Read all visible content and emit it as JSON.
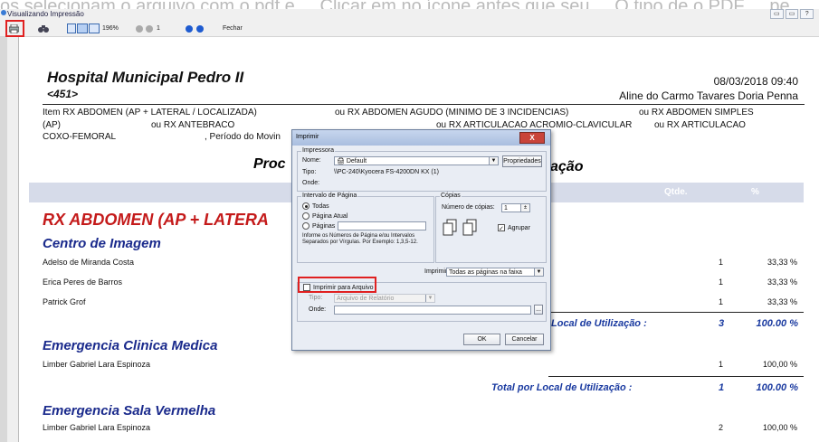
{
  "background_text": "os selecionam o arquivo com o pdf e ... Clicar em no ícone antes que seu ... O tipo de o PDF ... pe",
  "window": {
    "title": "Visualizando Impressão",
    "controls": [
      "▭",
      "▭",
      "?"
    ]
  },
  "toolbar": {
    "zoom": "196%",
    "page": "1",
    "close_label": "Fechar"
  },
  "report": {
    "hospital": "Hospital Municipal Pedro II",
    "code": "<451>",
    "datetime": "08/03/2018 09:40",
    "user": "Aline do Carmo Tavares Doria Penna",
    "filter_lines": [
      [
        "Item RX ABDOMEN (AP + LATERAL / LOCALIZADA)",
        "ou RX ABDOMEN AGUDO (MINIMO DE 3 INCIDENCIAS)",
        "ou RX ABDOMEN SIMPLES"
      ],
      [
        "(AP)",
        "ou RX ANTEBRACO",
        "ou RX ARTICULACAO ACROMIO-CLAVICULAR",
        "ou RX ARTICULACAO"
      ],
      [
        "COXO-FEMORAL",
        ", Período do Movin"
      ]
    ],
    "report_title": "Proc",
    "report_title_end": "ação",
    "col_qty": "Qtde.",
    "col_pct": "%",
    "section": "RX ABDOMEN (AP + LATERA",
    "groups": [
      {
        "name": "Centro de Imagem",
        "rows": [
          {
            "name": "Adelso de Miranda Costa",
            "qty": "1",
            "pct": "33,33 %"
          },
          {
            "name": "Erica Peres de Barros",
            "qty": "1",
            "pct": "33,33 %"
          },
          {
            "name": "Patrick Grof",
            "qty": "1",
            "pct": "33,33 %"
          }
        ],
        "total_label": "Local de Utilização :",
        "total_qty": "3",
        "total_pct": "100.00 %"
      },
      {
        "name": "Emergencia Clinica Medica",
        "rows": [
          {
            "name": "Limber Gabriel Lara Espinoza",
            "qty": "1",
            "pct": "100,00 %"
          }
        ],
        "total_label": "Total por Local de Utilização :",
        "total_qty": "1",
        "total_pct": "100.00 %"
      },
      {
        "name": "Emergencia Sala Vermelha",
        "rows": [
          {
            "name": "Limber Gabriel Lara Espinoza",
            "qty": "2",
            "pct": "100,00 %"
          }
        ]
      }
    ]
  },
  "dialog": {
    "title": "Imprimir",
    "close": "X",
    "printer_group": "Impressora",
    "name_label": "Nome:",
    "name_value": "Default",
    "properties_button": "Propriedades",
    "type_label": "Tipo:",
    "type_value": "\\\\PC-240\\Kyocera FS-4200DN KX (1)",
    "where_label": "Onde:",
    "range_group": "Intervalo de Página",
    "opt_all": "Todas",
    "opt_current": "Página Atual",
    "opt_pages": "Páginas",
    "range_hint": "Informe os Números de Página e/ou Intervalos Separados por Vírgulas. Por Exemplo: 1,3,5-12.",
    "copies_group": "Cópias",
    "copies_label": "Número de cópias:",
    "copies_value": "1",
    "collate_label": "Agrupar",
    "print_label": "Imprimir",
    "print_value": "Todas as páginas na faixa",
    "print_to_file": "Imprimir para Arquivo",
    "file_type_label": "Tipo:",
    "file_type_value": "Arquivo de Relatório",
    "file_where_label": "Onde:",
    "browse": "...",
    "ok": "OK",
    "cancel": "Cancelar"
  }
}
